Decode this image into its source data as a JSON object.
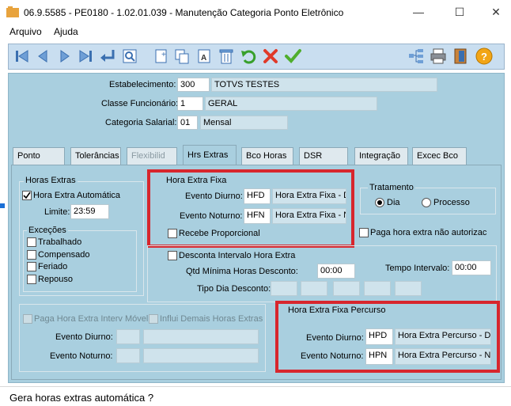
{
  "window": {
    "title": "06.9.5585 - PE0180 - 1.02.01.039 - Manutenção Categoria Ponto Eletrônico",
    "minimize": "—",
    "maximize": "☐",
    "close": "✕"
  },
  "menu": {
    "items": [
      "Arquivo",
      "Ajuda"
    ]
  },
  "toolbar": {
    "icons": [
      "first-icon",
      "prev-icon",
      "next-icon",
      "last-icon",
      "goto-icon",
      "search-icon",
      "new-icon",
      "copy-icon",
      "text-icon",
      "delete-icon",
      "undo-icon",
      "cancel-icon",
      "save-icon",
      "hierarchy-icon",
      "print-icon",
      "exit-icon",
      "help-icon"
    ]
  },
  "header": {
    "estabelecimento": {
      "label": "Estabelecimento:",
      "code": "300",
      "name": "TOTVS TESTES"
    },
    "classe": {
      "label": "Classe Funcionário:",
      "code": "1",
      "name": "GERAL"
    },
    "categoria": {
      "label": "Categoria Salarial:",
      "code": "01",
      "name": "Mensal"
    }
  },
  "tabs": [
    "Ponto",
    "Tolerâncias",
    "Flexibilid",
    "Hrs Extras",
    "Bco Horas",
    "DSR",
    "Integração",
    "Excec Bco"
  ],
  "horas_extras": {
    "title": "Horas Extras",
    "automatica": "Hora Extra Automática",
    "limite_label": "Limite:",
    "limite_value": "23:59"
  },
  "excecoes": {
    "title": "Exceções",
    "items": [
      "Trabalhado",
      "Compensado",
      "Feriado",
      "Repouso"
    ]
  },
  "fixa": {
    "title": "Hora Extra Fixa",
    "diurno_label": "Evento Diurno:",
    "diurno_code": "HFD",
    "diurno_desc": "Hora Extra Fixa - D",
    "noturno_label": "Evento Noturno:",
    "noturno_code": "HFN",
    "noturno_desc": "Hora Extra Fixa - N",
    "proporcional": "Recebe Proporcional"
  },
  "tratamento": {
    "title": "Tratamento",
    "dia": "Dia",
    "processo": "Processo"
  },
  "paga_nao_autorizada": "Paga hora extra não autorizac",
  "intervalo": {
    "desconta": "Desconta Intervalo Hora Extra",
    "qtd_label": "Qtd Mínima Horas Desconto:",
    "qtd_value": "00:00",
    "tempo_label": "Tempo Intervalo:",
    "tempo_value": "00:00",
    "tipo_label": "Tipo Dia Desconto:"
  },
  "interv_movel": {
    "paga": "Paga Hora Extra Interv Móvel",
    "influi": "Influi Demais Horas Extras",
    "diurno_label": "Evento Diurno:",
    "noturno_label": "Evento Noturno:"
  },
  "percurso": {
    "title": "Hora Extra Fixa Percurso",
    "diurno_label": "Evento Diurno:",
    "diurno_code": "HPD",
    "diurno_desc": "Hora Extra Percurso - Diu",
    "noturno_label": "Evento Noturno:",
    "noturno_code": "HPN",
    "noturno_desc": "Hora Extra Percurso - No"
  },
  "status": {
    "text": "Gera horas extras automática ?"
  },
  "colors": {
    "accent_red": "#d7262d",
    "panel": "#a9cfdf",
    "toolbar": "#c9def0"
  }
}
